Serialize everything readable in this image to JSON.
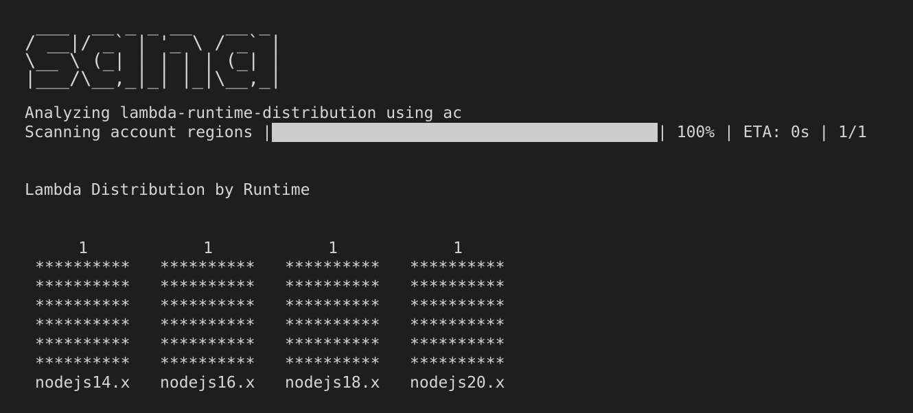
{
  "logo": " ___  __ _ _ __   __ _\n/ __|/ _` | '_ \\ / _` |\n\\__ \\ (_| | | | | (_| |\n|___/\\__,_|_| |_|\\__,_|",
  "analyzing_text": "Analyzing lambda-runtime-distribution using ac",
  "progress": {
    "label": "Scanning account regions |",
    "fraction": 1.0,
    "suffix": "| 100% | ETA: 0s | 1/1"
  },
  "heading": "Lambda Distribution by Runtime",
  "chart_data": {
    "type": "bar",
    "title": "Lambda Distribution by Runtime",
    "categories": [
      "nodejs14.x",
      "nodejs16.x",
      "nodejs18.x",
      "nodejs20.x"
    ],
    "values": [
      1,
      1,
      1,
      1
    ],
    "value_labels": [
      "1",
      "1",
      "1",
      "1"
    ],
    "bar_glyph": "**********",
    "bar_rows": 6,
    "ylim": [
      0,
      1
    ]
  }
}
